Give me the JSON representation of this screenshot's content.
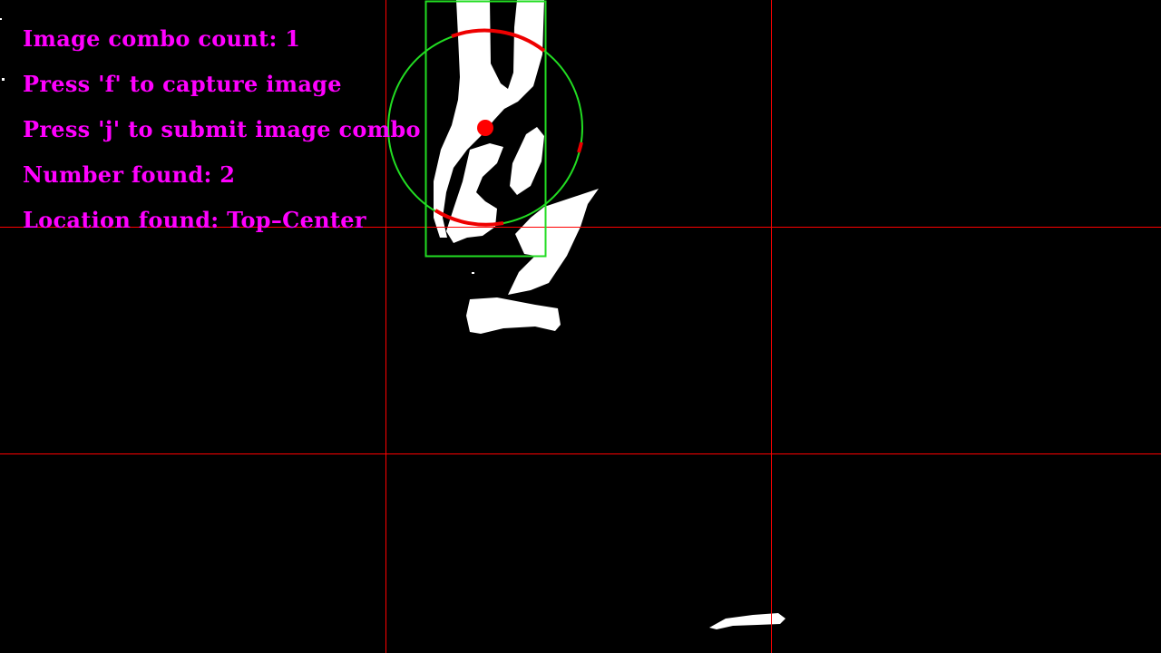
{
  "overlay": {
    "text_color": "#ff00ff",
    "lines": {
      "combo_count": "Image combo count: 1",
      "capture_hint": "Press 'f' to capture image",
      "submit_hint": "Press 'j' to submit image combo",
      "number_found": "Number found: 2",
      "location_found": "Location found: Top–Center"
    }
  },
  "colors": {
    "background": "#000000",
    "mask": "#ffffff",
    "grid_lines": "#ff0000",
    "bounding_box": "#22dd22",
    "detection_circle": "#22dd22",
    "detection_arc": "#ee0000",
    "center_marker": "#ff0000"
  },
  "grid": {
    "columns": 3,
    "rows": 3
  }
}
